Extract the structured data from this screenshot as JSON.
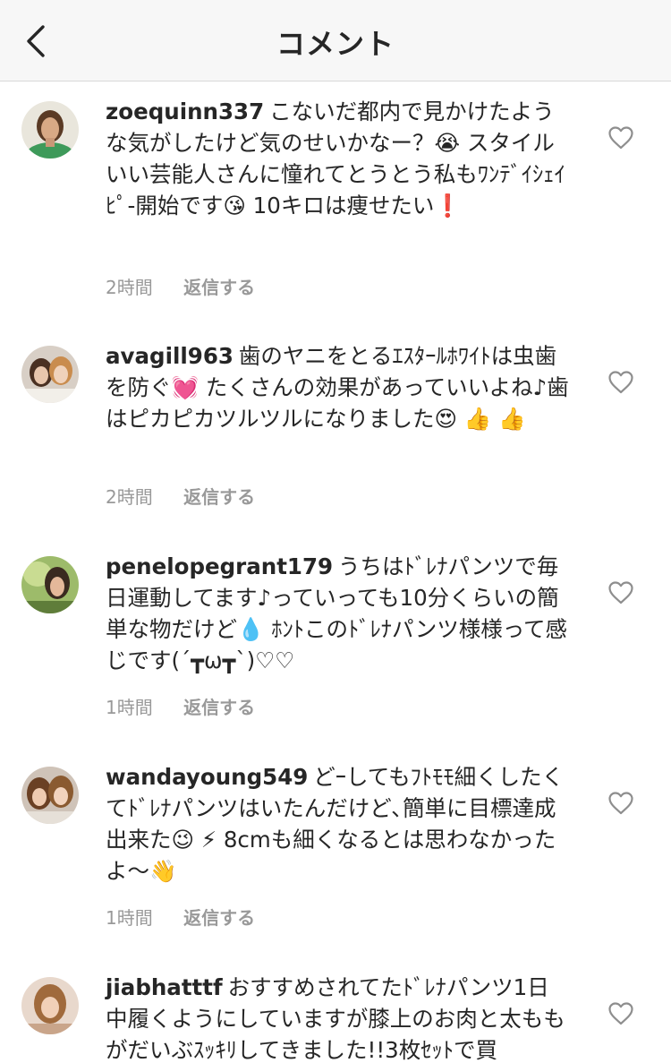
{
  "header": {
    "title": "コメント",
    "back_icon": "chevron-left-icon"
  },
  "comments": [
    {
      "username": "zoequinn337",
      "text": "こないだ都内で見かけたような気がしたけど気のせいかなー？😭 スタイルいい芸能人さんに憧れてとうとう私もﾜﾝﾃﾞｲｼｪｲﾋﾟ-開始です😘 10キロは痩せたい❗",
      "time": "2時間",
      "reply": "返信する"
    },
    {
      "username": "avagill963",
      "text": "歯のヤニをとるｴｽﾀｰﾙﾎﾜｲﾄは虫歯を防ぐ💓 たくさんの効果があっていいよね♪歯はピカピカツルツルになりました😍 👍 👍",
      "time": "2時間",
      "reply": "返信する"
    },
    {
      "username": "penelopegrant179",
      "text": "うちはﾄﾞﾚﾅパンツで毎日運動してます♪っていっても10分くらいの簡単な物だけど💧 ﾎﾝﾄこのﾄﾞﾚﾅパンツ様様って感じです(´┳ω┳`)♡♡",
      "time": "1時間",
      "reply": "返信する"
    },
    {
      "username": "wandayoung549",
      "text": "どｰしてもﾌﾄﾓﾓ細くしたくてﾄﾞﾚﾅパンツはいたんだけど､簡単に目標達成出来た😉 ⚡ 8cmも細くなるとは思わなかったよ〜👋",
      "time": "1時間",
      "reply": "返信する"
    },
    {
      "username": "jiabhatttf",
      "text": "おすすめされてたﾄﾞﾚﾅパンツ1日中履くようにしていますが膝上のお肉と太ももがだいぶｽｯｷﾘしてきました!!3枚ｾｯﾄで買",
      "time": "",
      "reply": ""
    }
  ]
}
